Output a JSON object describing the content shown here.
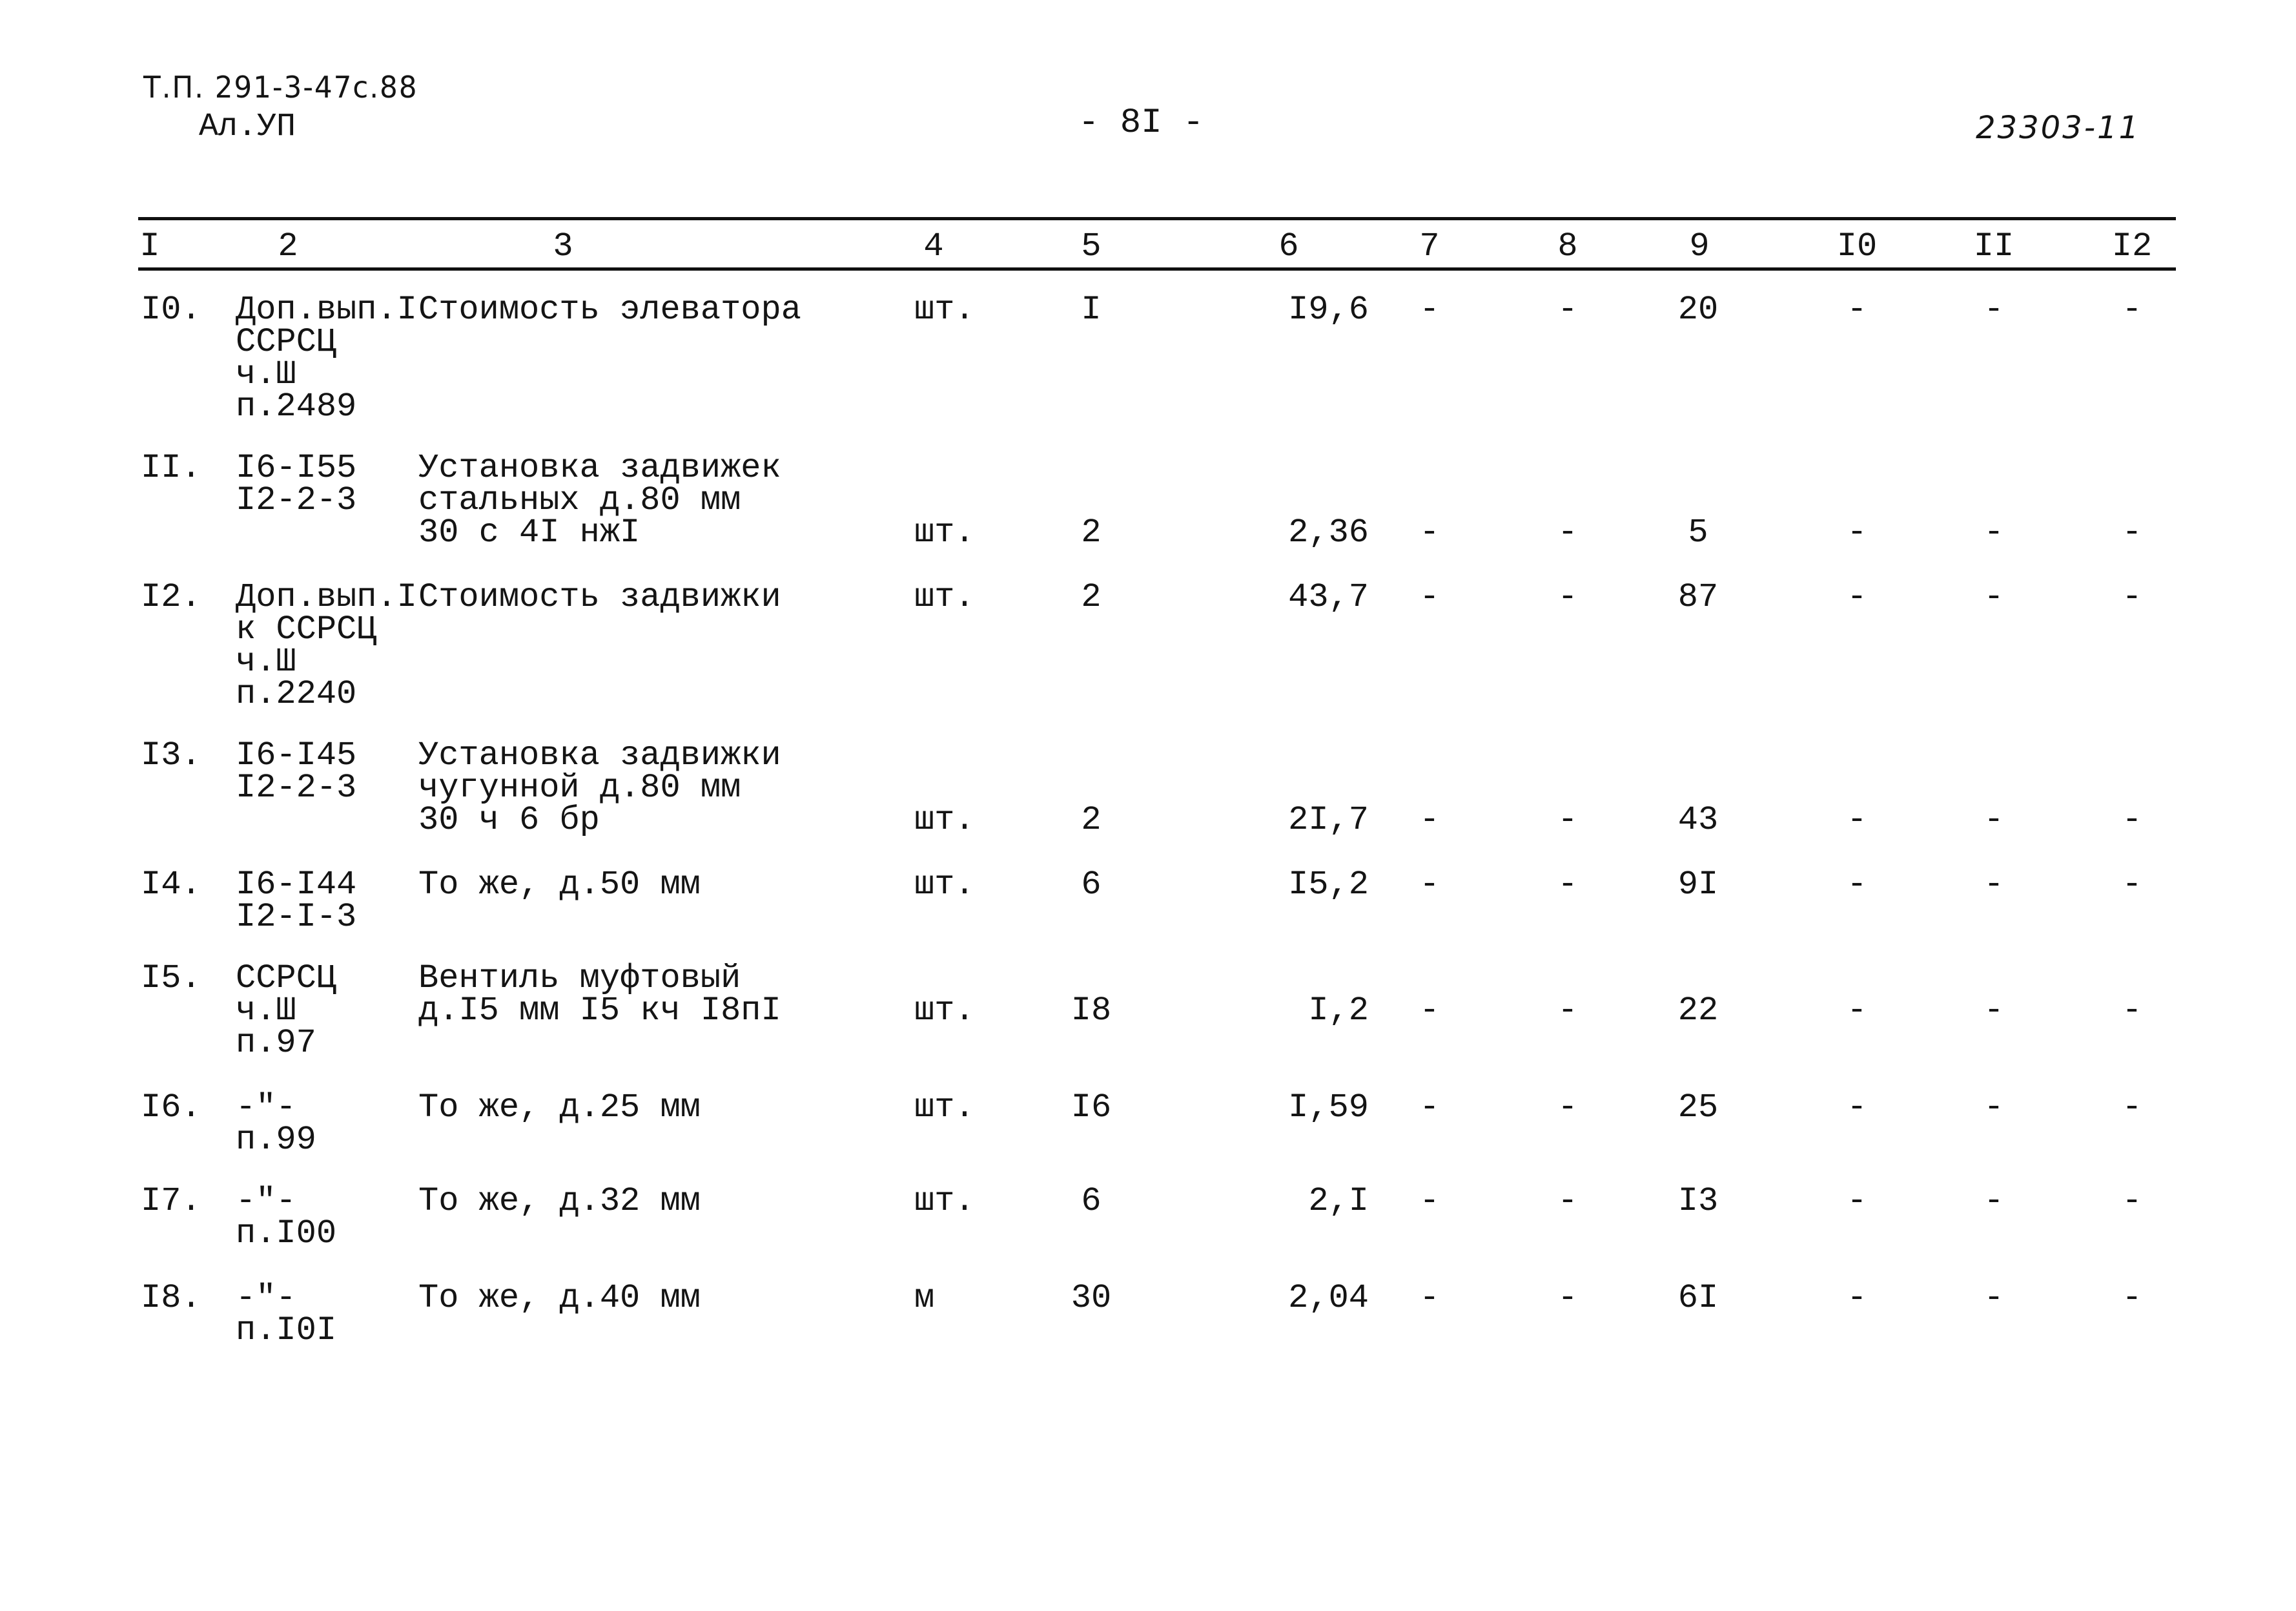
{
  "header": {
    "doc_ref": "Т.П. 291-3-47с.88",
    "album": "Ал.УП",
    "page_number": "- 8I -",
    "stamp_number": "23303-11"
  },
  "table": {
    "column_numbers": [
      "I",
      "2",
      "3",
      "4",
      "5",
      "6",
      "7",
      "8",
      "9",
      "I0",
      "II",
      "I2"
    ],
    "rows": [
      {
        "num": "I0.",
        "code": "Доп.вып.I\nССРСЦ\nч.Ш\nп.2489",
        "desc": "Стоимость элеватора",
        "unit": "шт.",
        "qty": "I",
        "price": "I9,6",
        "c7": "-",
        "c8": "-",
        "total": "20",
        "c10": "-",
        "c11": "-",
        "c12": "-"
      },
      {
        "num": "II.",
        "code": "I6-I55\nI2-2-3",
        "desc": "Установка задвижек\nстальных д.80 мм\n30 с 4I нжI",
        "unit": "шт.",
        "qty": "2",
        "price": "2,36",
        "c7": "-",
        "c8": "-",
        "total": "5",
        "c10": "-",
        "c11": "-",
        "c12": "-"
      },
      {
        "num": "I2.",
        "code": "Доп.вып.I\nк ССРСЦ\nч.Ш\nп.2240",
        "desc": "Стоимость задвижки",
        "unit": "шт.",
        "qty": "2",
        "price": "43,7",
        "c7": "-",
        "c8": "-",
        "total": "87",
        "c10": "-",
        "c11": "-",
        "c12": "-"
      },
      {
        "num": "I3.",
        "code": "I6-I45\nI2-2-3",
        "desc": "Установка задвижки\nчугунной д.80 мм\n30 ч 6 бр",
        "unit": "шт.",
        "qty": "2",
        "price": "2I,7",
        "c7": "-",
        "c8": "-",
        "total": "43",
        "c10": "-",
        "c11": "-",
        "c12": "-"
      },
      {
        "num": "I4.",
        "code": "I6-I44\nI2-I-3",
        "desc": "То же, д.50 мм",
        "unit": "шт.",
        "qty": "6",
        "price": "I5,2",
        "c7": "-",
        "c8": "-",
        "total": "9I",
        "c10": "-",
        "c11": "-",
        "c12": "-"
      },
      {
        "num": "I5.",
        "code": "ССРСЦ\nч.Ш\nп.97",
        "desc": "Вентиль муфтовый\nд.I5 мм I5 кч I8пI",
        "unit": "шт.",
        "qty": "I8",
        "price": "I,2",
        "c7": "-",
        "c8": "-",
        "total": "22",
        "c10": "-",
        "c11": "-",
        "c12": "-"
      },
      {
        "num": "I6.",
        "code": "-\"-\nп.99",
        "desc": "То же, д.25 мм",
        "unit": "шт.",
        "qty": "I6",
        "price": "I,59",
        "c7": "-",
        "c8": "-",
        "total": "25",
        "c10": "-",
        "c11": "-",
        "c12": "-"
      },
      {
        "num": "I7.",
        "code": "-\"-\nп.I00",
        "desc": "То же, д.32 мм",
        "unit": "шт.",
        "qty": "6",
        "price": "2,I",
        "c7": "-",
        "c8": "-",
        "total": "I3",
        "c10": "-",
        "c11": "-",
        "c12": "-"
      },
      {
        "num": "I8.",
        "code": "-\"-\nп.I0I",
        "desc": "То же, д.40 мм",
        "unit": "м",
        "qty": "30",
        "price": "2,04",
        "c7": "-",
        "c8": "-",
        "total": "6I",
        "c10": "-",
        "c11": "-",
        "c12": "-"
      }
    ]
  }
}
